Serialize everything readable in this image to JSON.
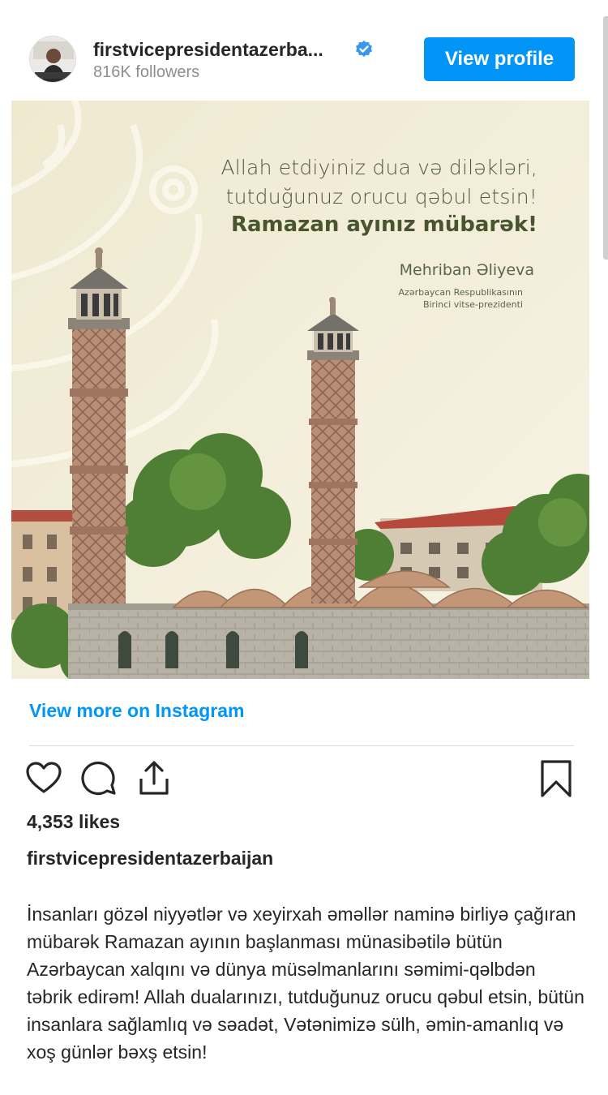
{
  "header": {
    "username": "firstvicepresidentazerba...",
    "followers": "816K followers",
    "view_profile_label": "View profile"
  },
  "post": {
    "image": {
      "greeting_line1": "Allah etdiyiniz dua və diləkləri,",
      "greeting_line2": "tutduğunuz orucu qəbul etsin!",
      "greeting_line3": "Ramazan ayınız mübarək!",
      "signer_name": "Mehriban Əliyeva",
      "signer_title_line1": "Azərbaycan Respublikasının",
      "signer_title_line2": "Birinci vitse-prezidenti"
    },
    "view_more_label": "View more on Instagram",
    "likes": "4,353 likes",
    "caption_username": "firstvicepresidentazerbaijan",
    "caption_text": "İnsanları gözəl niyyətlər və xeyirxah əməllər naminə birliyə çağıran mübarək Ramazan ayının başlanması münasibətilə bütün Azərbaycan xalqını və dünya müsəlmanlarını səmimi-qəlbdən təbrik edirəm! Allah dualarınızı, tutduğunuz orucu qəbul etsin, bütün insanlara sağlamlıq və səadət, Vətənimizə sülh, əmin-amanlıq və xoş günlər bəxş etsin!"
  },
  "actions": {
    "icons": [
      "heart-icon",
      "comment-icon",
      "share-icon",
      "bookmark-icon"
    ]
  },
  "colors": {
    "accent": "#0095f6",
    "text": "#262626",
    "muted": "#8e8e8e",
    "image_background": "#f1ecd6"
  }
}
